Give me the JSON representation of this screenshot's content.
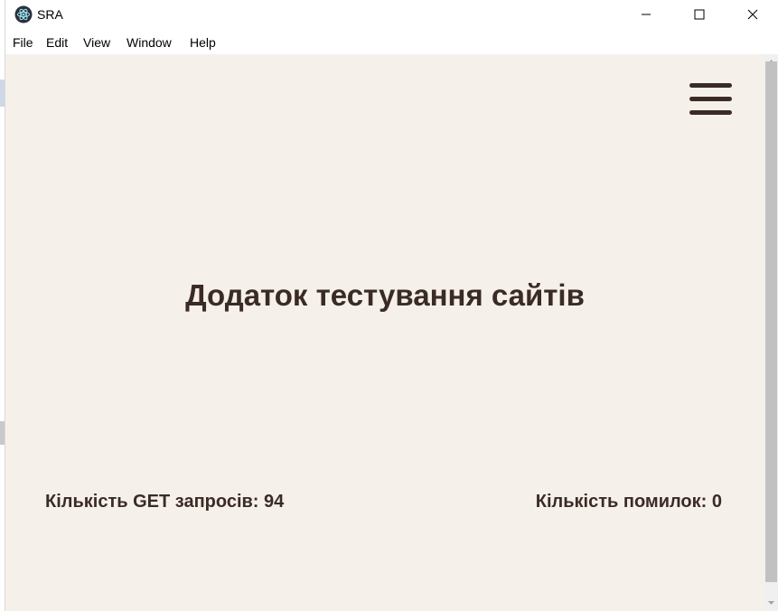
{
  "window": {
    "title": "SRA",
    "controls": {
      "minimize_icon": "minimize-icon",
      "maximize_icon": "maximize-icon",
      "close_icon": "close-icon"
    }
  },
  "menubar": {
    "items": [
      "File",
      "Edit",
      "View",
      "Window",
      "Help"
    ]
  },
  "page": {
    "menu_icon": "hamburger-menu-icon",
    "title": "Додаток тестування сайтів",
    "get_requests_label": "Кількість GET запросів: 94",
    "errors_label": "Кількість помилок: 0"
  },
  "colors": {
    "background": "#f6f0eb",
    "text": "#3a2b25",
    "scrollbar_thumb": "#c1c1c1"
  }
}
